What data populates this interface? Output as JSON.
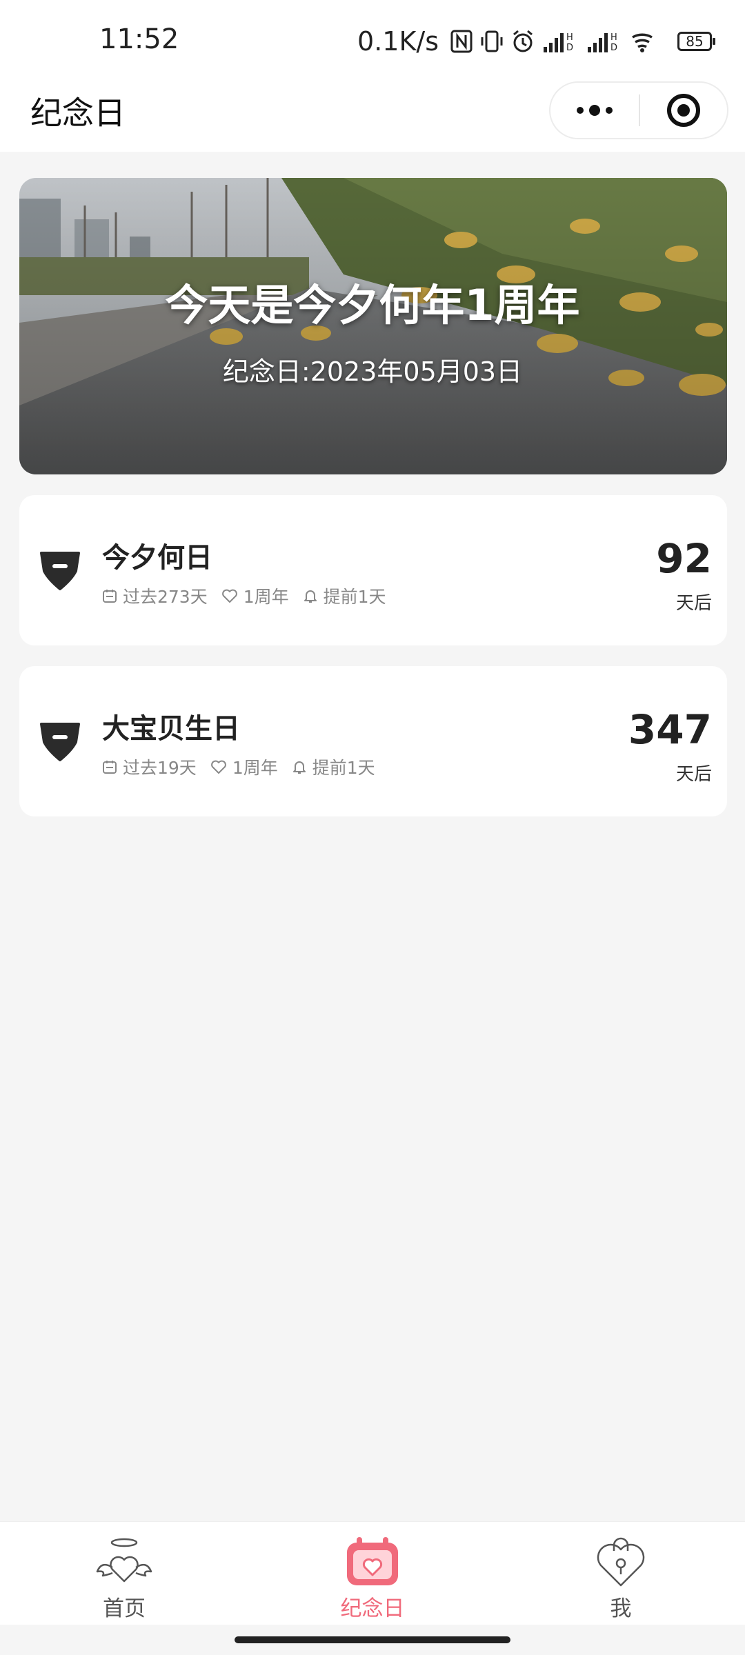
{
  "status_bar": {
    "time": "11:52",
    "net_speed": "0.1K/s",
    "battery": "85",
    "icons": [
      "nfc-icon",
      "vibrate-icon",
      "alarm-icon",
      "signal-icon",
      "signal-icon",
      "wifi-icon",
      "battery-icon"
    ]
  },
  "nav": {
    "title": "纪念日",
    "more_icon": "more-dots-icon",
    "close_icon": "target-close-icon"
  },
  "banner": {
    "title": "今天是今夕何年1周年",
    "subtitle": "纪念日:2023年05月03日"
  },
  "anniversaries": [
    {
      "icon": "gem-icon",
      "title": "今夕何日",
      "past": "过去273天",
      "cycle": "1周年",
      "remind": "提前1天",
      "days": "92",
      "unit": "天后"
    },
    {
      "icon": "gem-icon",
      "title": "大宝贝生日",
      "past": "过去19天",
      "cycle": "1周年",
      "remind": "提前1天",
      "days": "347",
      "unit": "天后"
    }
  ],
  "tabs": [
    {
      "label": "首页",
      "icon": "angel-heart-icon",
      "active": false
    },
    {
      "label": "纪念日",
      "icon": "calendar-heart-icon",
      "active": true
    },
    {
      "label": "我",
      "icon": "heart-lock-icon",
      "active": false
    }
  ],
  "colors": {
    "accent": "#f06a7b",
    "background": "#f5f5f5",
    "card": "#ffffff"
  }
}
